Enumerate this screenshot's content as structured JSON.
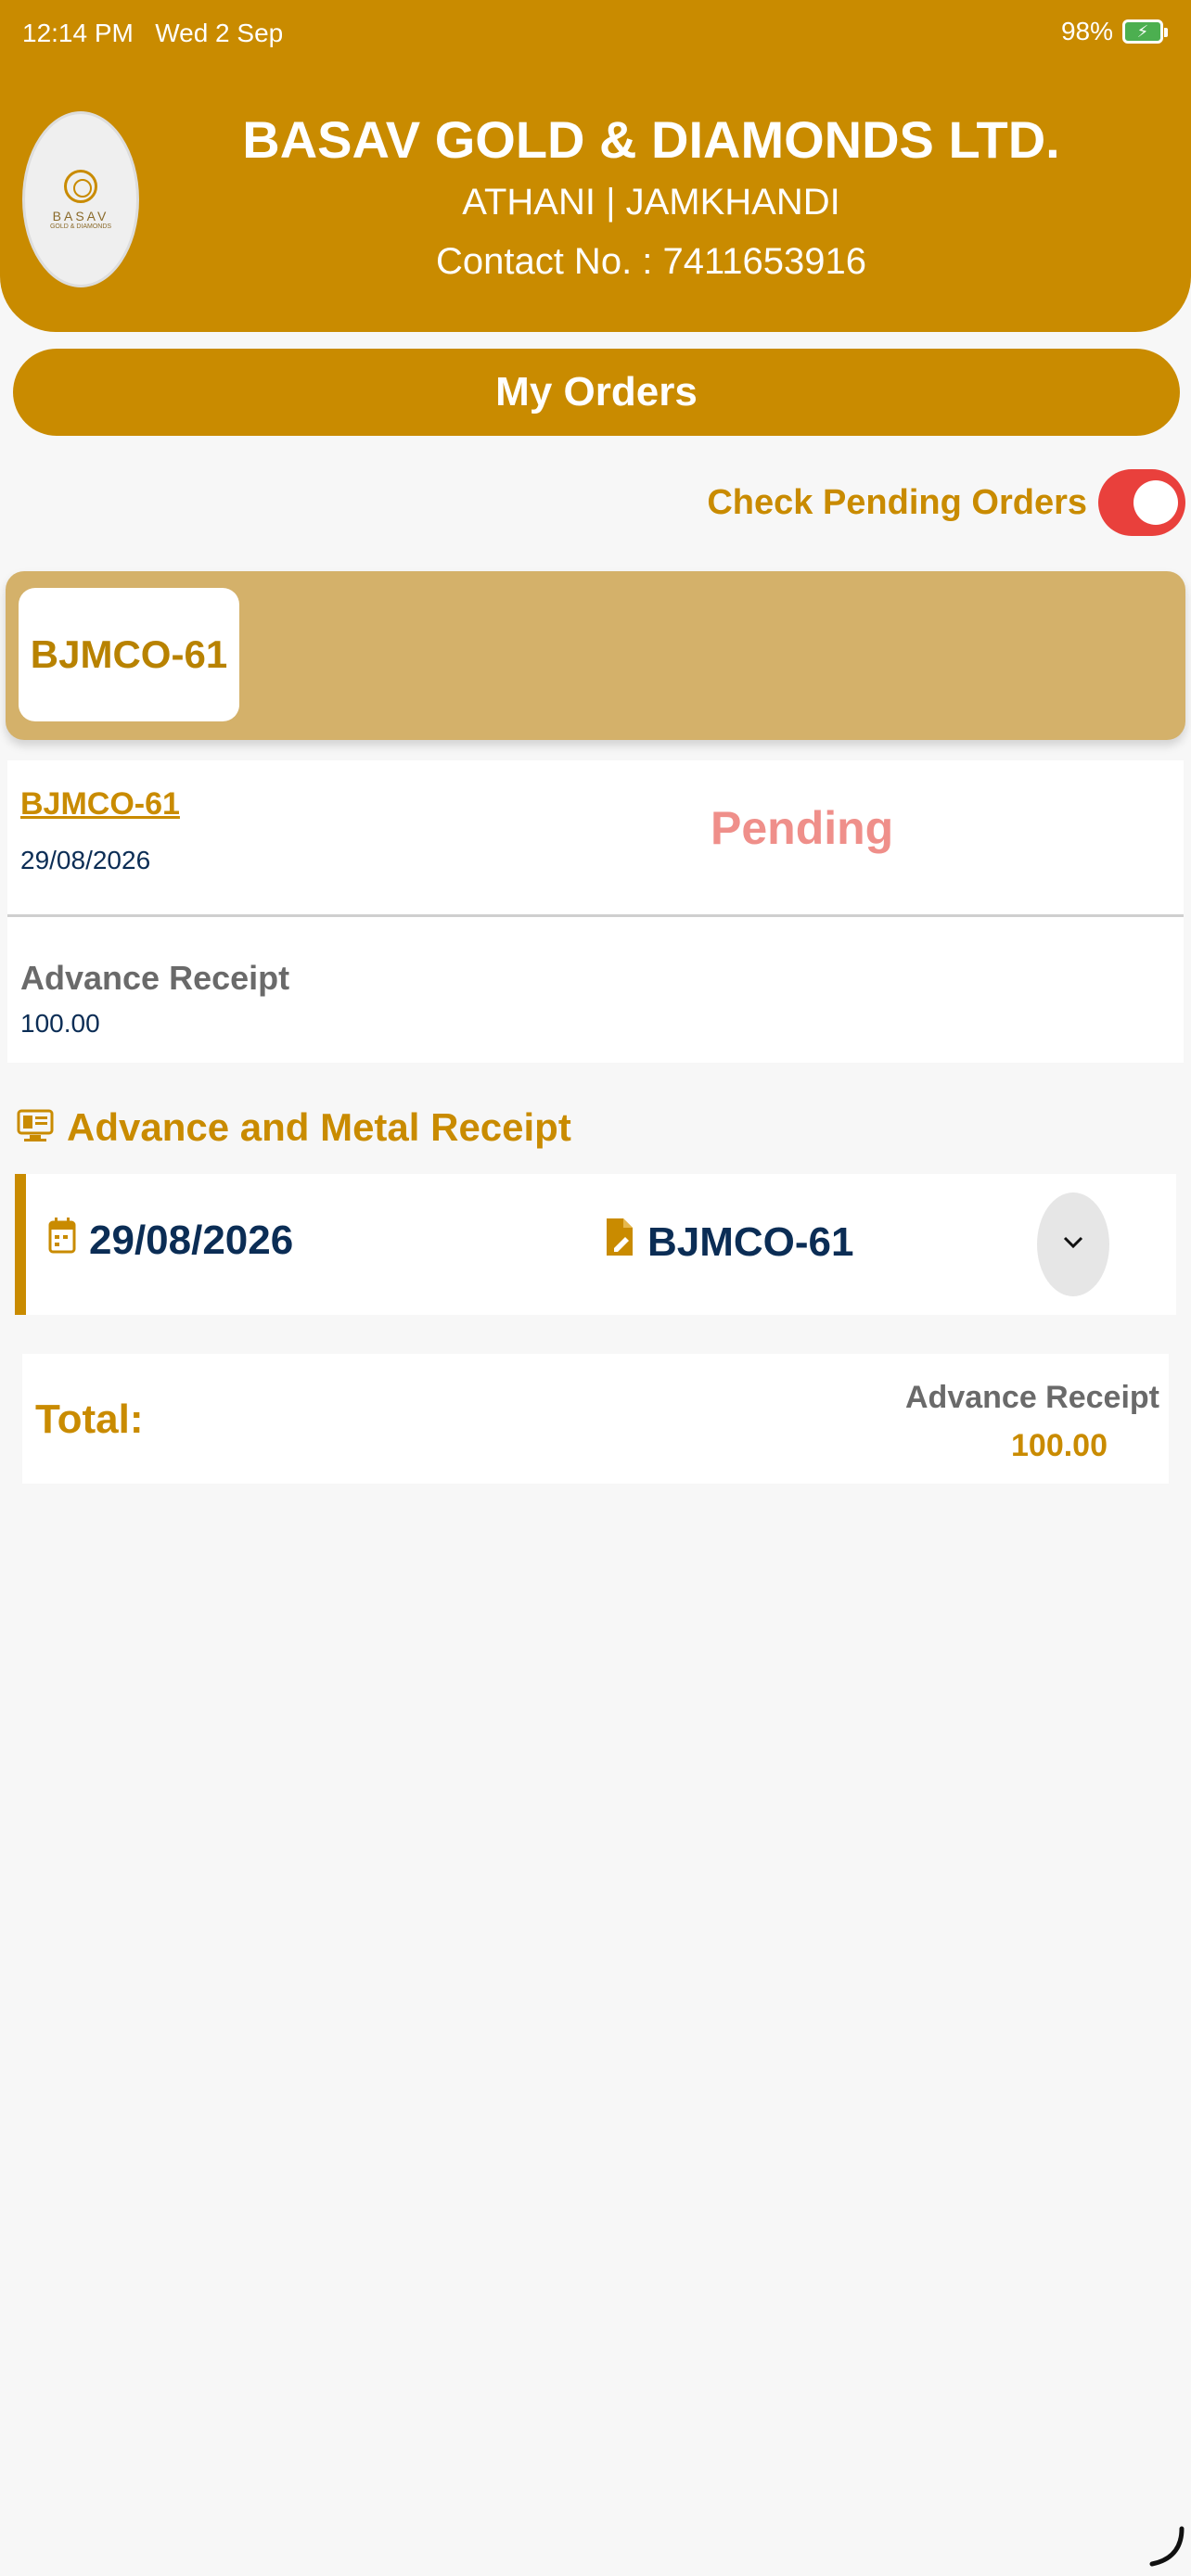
{
  "status_bar": {
    "time": "12:14 PM",
    "date": "Wed 2 Sep",
    "battery": "98%"
  },
  "header": {
    "logo_text": "BASAV",
    "logo_sub": "GOLD & DIAMONDS",
    "company_name": "BASAV GOLD & DIAMONDS LTD.",
    "city": "ATHANI | JAMKHANDI",
    "contact": "Contact No. : 7411653916"
  },
  "page_title": "My Orders",
  "pending_toggle": {
    "label": "Check Pending Orders",
    "enabled": true
  },
  "order_tabs": [
    {
      "label": "BJMCO-61"
    }
  ],
  "order": {
    "id": "BJMCO-61",
    "date": "29/08/2026",
    "status": "Pending",
    "advance_label": "Advance Receipt",
    "advance_value": "100.00"
  },
  "section": {
    "title": "Advance and Metal Receipt"
  },
  "receipt": {
    "date": "29/08/2026",
    "code": "BJMCO-61"
  },
  "total": {
    "label": "Total:",
    "advance_label": "Advance Receipt",
    "advance_value": "100.00"
  },
  "colors": {
    "brand": "#c98b00",
    "tab_bar": "#d4b16a",
    "status_pending": "#ef8f8a",
    "toggle_on": "#e9403c",
    "text_dark": "#0b2d55"
  }
}
